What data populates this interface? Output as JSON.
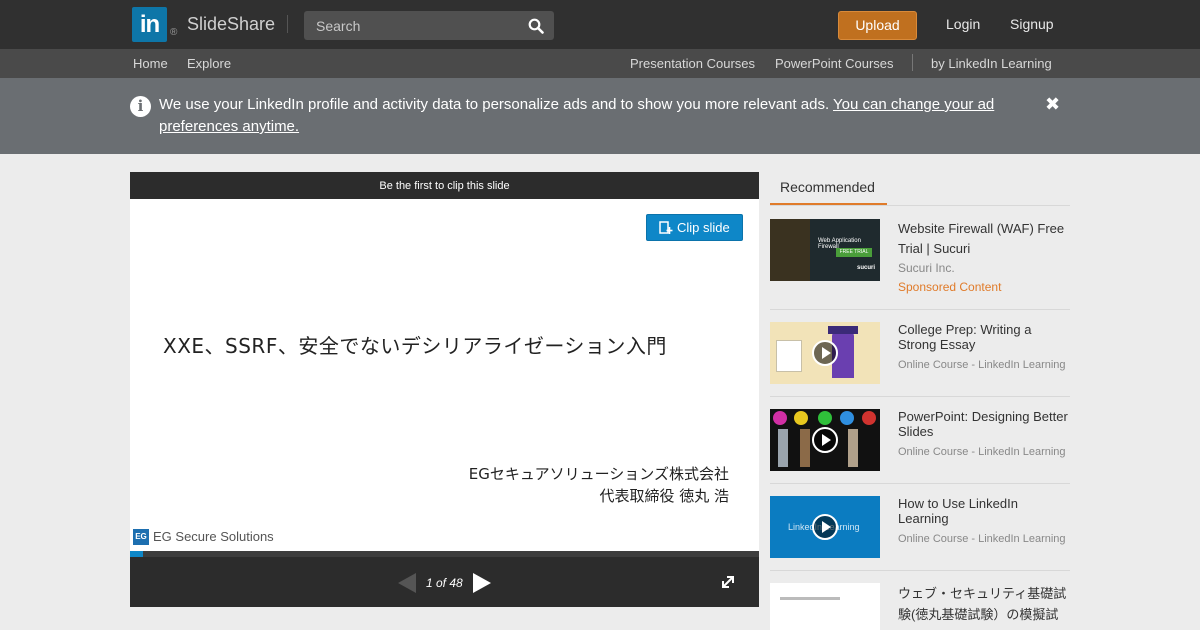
{
  "header": {
    "brand_short": "in",
    "brand_reg": "®",
    "brand_name": "SlideShare",
    "search_placeholder": "Search",
    "upload_label": "Upload",
    "login_label": "Login",
    "signup_label": "Signup"
  },
  "subnav": {
    "home": "Home",
    "explore": "Explore",
    "presentation_courses": "Presentation Courses",
    "powerpoint_courses": "PowerPoint Courses",
    "by_linkedin": "by LinkedIn Learning"
  },
  "notice": {
    "text": "We use your LinkedIn profile and activity data to personalize ads and to show you more relevant ads.",
    "link": "You can change your ad preferences anytime."
  },
  "player": {
    "clip_header": "Be the first to clip this slide",
    "clip_button": "Clip slide",
    "slide_title": "XXE、SSRF、安全でないデシリアライゼーション入門",
    "slide_company": "EGセキュアソリューションズ株式会社",
    "slide_author": "代表取締役 徳丸 浩",
    "slide_logo_short": "EG",
    "slide_logo_text": "EG Secure Solutions",
    "page_indicator": "1 of 48",
    "current_page": 1,
    "total_pages": 48
  },
  "sidebar": {
    "tab_label": "Recommended",
    "items": [
      {
        "title": "Website Firewall (WAF) Free Trial | Sucuri",
        "sub": "Sucuri Inc.",
        "sponsored": "Sponsored Content",
        "thumb_title": "Web Application Firewall",
        "thumb_badge": "FREE TRIAL",
        "thumb_brand": "sucuri"
      },
      {
        "title": "College Prep: Writing a Strong Essay",
        "sub": "Online Course - LinkedIn Learning"
      },
      {
        "title": "PowerPoint: Designing Better Slides",
        "sub": "Online Course - LinkedIn Learning"
      },
      {
        "title": "How to Use LinkedIn Learning",
        "sub": "Online Course - LinkedIn Learning",
        "thumb_title": "LinkedIn Learning"
      },
      {
        "title": "ウェブ・セキュリティ基礎試験(徳丸基礎試験）の模擬試"
      }
    ]
  },
  "colors": {
    "topbar": "#303030",
    "subnav": "#4a4a4a",
    "notice": "#6a6e72",
    "accent_orange": "#e07b2a",
    "upload_button": "#c0701f",
    "linkedin_blue": "#0e76a8",
    "clip_blue": "#0e87c8"
  }
}
